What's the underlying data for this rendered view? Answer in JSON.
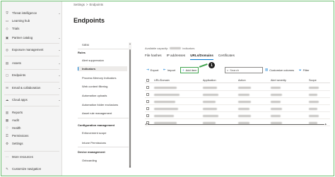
{
  "nav": {
    "items": [
      {
        "label": "Threat intelligence",
        "icon": "shield-icon",
        "has_chevron": true
      },
      {
        "label": "Learning hub",
        "icon": "book-icon",
        "has_chevron": false
      },
      {
        "label": "Trials",
        "icon": "trial-icon",
        "has_chevron": false
      },
      {
        "label": "Partner catalog",
        "icon": "partner-icon",
        "has_chevron": true
      },
      {
        "label": "Exposure management",
        "icon": "exposure-icon",
        "has_chevron": true
      },
      {
        "label": "Assets",
        "icon": "assets-icon",
        "has_chevron": true
      },
      {
        "label": "Endpoints",
        "icon": "endpoint-icon",
        "has_chevron": true
      },
      {
        "label": "Email & collaboration",
        "icon": "email-icon",
        "has_chevron": true
      },
      {
        "label": "Cloud apps",
        "icon": "cloud-icon",
        "has_chevron": true
      },
      {
        "label": "Reports",
        "icon": "reports-icon",
        "has_chevron": false
      },
      {
        "label": "Audit",
        "icon": "audit-icon",
        "has_chevron": false
      },
      {
        "label": "Health",
        "icon": "health-icon",
        "has_chevron": false
      },
      {
        "label": "Permissions",
        "icon": "permissions-icon",
        "has_chevron": false
      },
      {
        "label": "Settings",
        "icon": "gear-icon",
        "has_chevron": false
      },
      {
        "label": "More resources",
        "icon": "more-icon",
        "has_chevron": false
      },
      {
        "label": "Customize navigation",
        "icon": "pencil-icon",
        "has_chevron": false
      }
    ]
  },
  "breadcrumb": {
    "items": [
      "Settings",
      "Endpoints"
    ],
    "separator": ">"
  },
  "page": {
    "title": "Endpoints"
  },
  "settings_list": {
    "items": [
      {
        "label": "SIEM",
        "type": "item"
      },
      {
        "label": "Rules",
        "type": "header"
      },
      {
        "label": "Alert suppression",
        "type": "item"
      },
      {
        "label": "Indicators",
        "type": "selected"
      },
      {
        "label": "Process Memory Indicators",
        "type": "item"
      },
      {
        "label": "Web content filtering",
        "type": "item"
      },
      {
        "label": "Automation uploads",
        "type": "item"
      },
      {
        "label": "Automation folder exclusions",
        "type": "item"
      },
      {
        "label": "Asset rule management",
        "type": "item"
      },
      {
        "label": "Configuration management",
        "type": "header"
      },
      {
        "label": "Enforcement scope",
        "type": "item"
      },
      {
        "label": "Intune Permissions",
        "type": "item"
      },
      {
        "label": "Device management",
        "type": "header"
      },
      {
        "label": "Onboarding",
        "type": "item"
      }
    ]
  },
  "capacity": {
    "prefix": "Available capacity:",
    "suffix": "indicators"
  },
  "tabs": [
    {
      "label": "File hashes",
      "active": false
    },
    {
      "label": "IP addresses",
      "active": false
    },
    {
      "label": "URLs/Domains",
      "active": true
    },
    {
      "label": "Certificates",
      "active": false
    }
  ],
  "toolbar": {
    "export_label": "Export",
    "import_label": "Import",
    "add_item_label": "Add item",
    "search_placeholder": "Search",
    "customize_columns_label": "Customize columns",
    "filter_label": "Filter"
  },
  "callout": {
    "number": "1",
    "color": "#3fa34d"
  },
  "table": {
    "columns": [
      "URL/Domain",
      "Application",
      "Action",
      "Alert severity",
      "Scope"
    ],
    "row_count": 6
  },
  "colors": {
    "accent": "#0078d4",
    "highlight": "#3fa34d"
  }
}
